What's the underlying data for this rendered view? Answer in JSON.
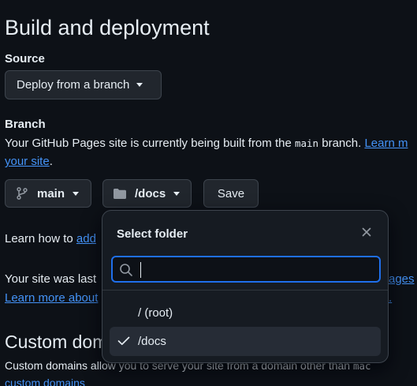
{
  "section": {
    "title": "Build and deployment",
    "source_label": "Source",
    "source_select": "Deploy from a branch",
    "branch_label": "Branch",
    "branch_desc_1": "Your GitHub Pages site is currently being built from the ",
    "branch_code": "main",
    "branch_desc_2": " branch. ",
    "branch_link_a": "Learn m",
    "branch_link_b": "your site",
    "branch_desc_end": ".",
    "branch_button": "main",
    "folder_button": "/docs",
    "save_button": "Save"
  },
  "learn_custom": {
    "prefix": "Learn how to ",
    "link": "add"
  },
  "deployed": {
    "text": "Your site was last ",
    "link_right": "ages",
    "learn_more": "Learn more about",
    "trailing": "."
  },
  "custom_domain": {
    "title": "Custom dom",
    "desc": "Custom domains allow you to serve your site from a domain other than ",
    "desc_code": "mac",
    "link": "custom domains"
  },
  "dropdown": {
    "title": "Select folder",
    "search_value": "",
    "options": [
      {
        "label": "/ (root)",
        "selected": false
      },
      {
        "label": "/docs",
        "selected": true
      }
    ]
  },
  "colors": {
    "background": "#0d1117",
    "link": "#4493f8",
    "focus": "#1f6feb"
  },
  "icons": {
    "branch": "git-branch-icon",
    "folder": "folder-icon",
    "close": "close-icon",
    "search": "search-icon",
    "check": "check-icon"
  }
}
